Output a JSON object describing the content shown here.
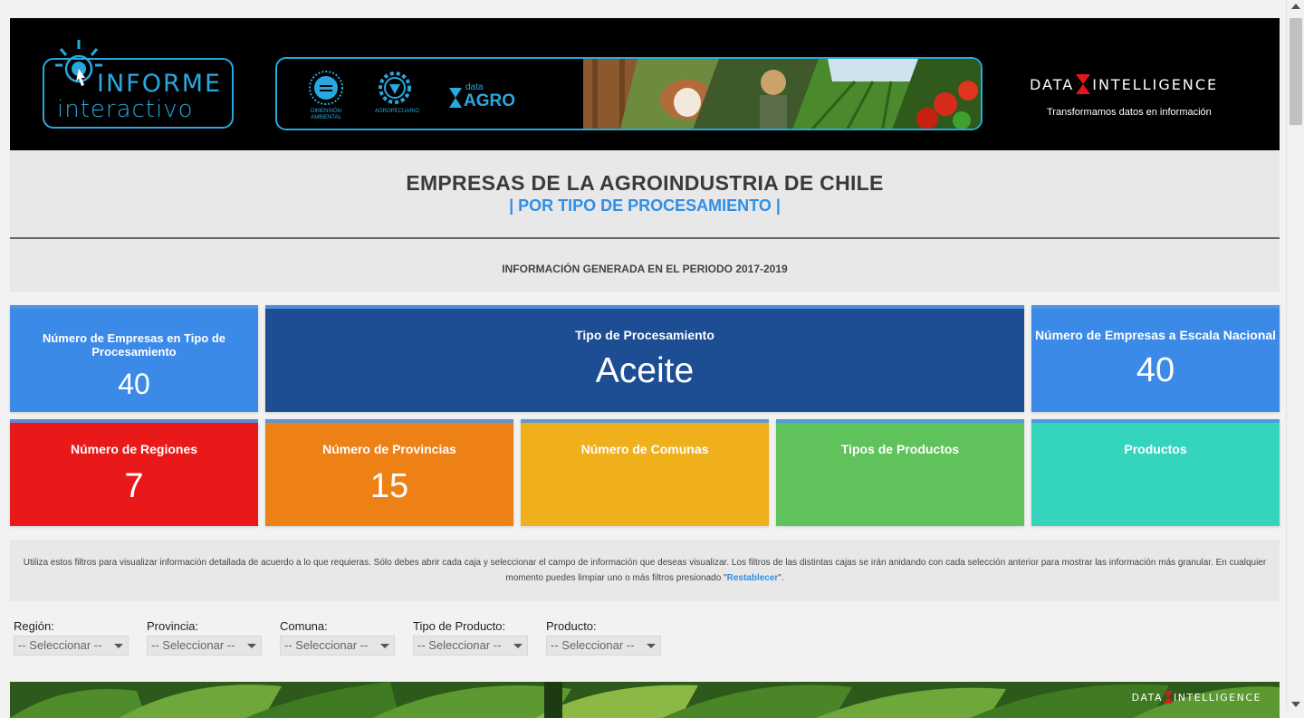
{
  "header": {
    "logo_line1": "INFORME",
    "logo_line2": "interactivo",
    "partner_logos": [
      "DIMENSIÓN AMBIENTAL",
      "AGROPECUARIO"
    ],
    "dataagro_small": "data",
    "dataagro_big": "AGRO",
    "di_left": "DATA",
    "di_right": "INTELLIGENCE",
    "di_tagline": "Transformamos datos en información"
  },
  "title": {
    "main": "EMPRESAS DE LA AGROINDUSTRIA DE CHILE",
    "sub": "| POR TIPO DE PROCESAMIENTO |",
    "period": "INFORMACIÓN GENERADA EN EL PERIODO 2017-2019"
  },
  "cards": {
    "empresas_tipo": {
      "label": "Número de Empresas en Tipo de Procesamiento",
      "value": "40"
    },
    "tipo_proc": {
      "label": "Tipo de Procesamiento",
      "value": "Aceite"
    },
    "empresas_nacional": {
      "label": "Número de Empresas a Escala Nacional",
      "value": "40"
    },
    "regiones": {
      "label": "Número de Regiones",
      "value": "7"
    },
    "provincias": {
      "label": "Número de Provincias",
      "value": "15"
    },
    "comunas": {
      "label": "Número de Comunas",
      "value": ""
    },
    "tipos_productos": {
      "label": "Tipos de Productos",
      "value": ""
    },
    "productos": {
      "label": "Productos",
      "value": ""
    }
  },
  "info": {
    "text_before": "Utiliza estos filtros para visualizar información detallada de acuerdo a lo que requieras. Sólo debes abrir cada caja y seleccionar el campo de información que deseas visualizar. Los filtros de las distintas cajas se irán anidando con cada selección anterior para mostrar las información más granular. En cualquier momento puedes limpiar uno o más filtros presionado \"",
    "link": "Restablecer",
    "text_after": "\"."
  },
  "filters": [
    {
      "label": "Región:",
      "value": "-- Seleccionar --"
    },
    {
      "label": "Provincia:",
      "value": "-- Seleccionar --"
    },
    {
      "label": "Comuna:",
      "value": "-- Seleccionar --"
    },
    {
      "label": "Tipo de Producto:",
      "value": "-- Seleccionar --"
    },
    {
      "label": "Producto:",
      "value": "-- Seleccionar --"
    }
  ],
  "footer": {
    "di_left": "DATA",
    "di_right": "INTELLIGENCE"
  },
  "colors": {
    "accent": "#2f8fe6",
    "card_blue": "#3c8ae8",
    "card_navy": "#1d4d93",
    "card_red": "#ea1919",
    "card_orange": "#ee8116",
    "card_yellow": "#efb01b",
    "card_green": "#5fc25a",
    "card_teal": "#34d4bd"
  }
}
